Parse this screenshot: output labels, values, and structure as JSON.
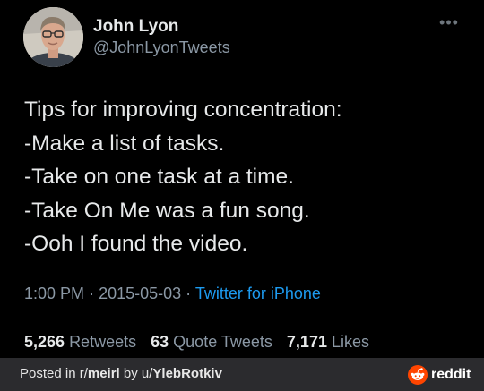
{
  "tweet": {
    "display_name": "John Lyon",
    "handle": "@JohnLyonTweets",
    "more_icon": "more-horizontal-icon",
    "text_lines": [
      "Tips for improving concentration:",
      "-Make a list of tasks.",
      "-Take on one task at a time.",
      "-Take On Me was a fun song.",
      "-Ooh I found the video."
    ],
    "time": "1:00 PM",
    "date": "2015-05-03",
    "separator": "·",
    "source": "Twitter for iPhone",
    "stats": {
      "retweets_count": "5,266",
      "retweets_label": "Retweets",
      "quote_tweets_count": "63",
      "quote_tweets_label": "Quote Tweets",
      "likes_count": "7,171",
      "likes_label": "Likes"
    }
  },
  "footer": {
    "posted_in_label": "Posted in r/",
    "subreddit": "meirl",
    "by_label": " by u/",
    "username": "YlebRotkiv",
    "brand_icon": "reddit-snoo-icon",
    "brand": "reddit"
  },
  "colors": {
    "background": "#000000",
    "text_primary": "#e7e9ea",
    "text_secondary": "#8b98a5",
    "link": "#1d9bf0",
    "footer_bg": "#2b2b2e",
    "reddit_orange": "#ff4500"
  }
}
